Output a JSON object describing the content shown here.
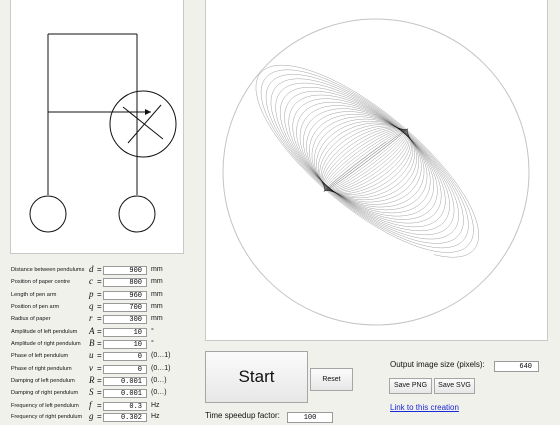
{
  "params": [
    {
      "label": "Distance between pendulums",
      "symbol": "d",
      "value": "900",
      "unit": "mm"
    },
    {
      "label": "Position of paper centre",
      "symbol": "c",
      "value": "800",
      "unit": "mm"
    },
    {
      "label": "Length of pen arm",
      "symbol": "p",
      "value": "960",
      "unit": "mm"
    },
    {
      "label": "Position of pen arm",
      "symbol": "q",
      "value": "700",
      "unit": "mm"
    },
    {
      "label": "Radius of paper",
      "symbol": "r",
      "value": "300",
      "unit": "mm"
    },
    {
      "label": "Amplitude of left pendulum",
      "symbol": "A",
      "value": "10",
      "unit": "°"
    },
    {
      "label": "Amplitude of right pendulum",
      "symbol": "B",
      "value": "10",
      "unit": "°"
    },
    {
      "label": "Phase of left pendulum",
      "symbol": "u",
      "value": "0",
      "unit": "(0…1)"
    },
    {
      "label": "Phase of right pendulum",
      "symbol": "v",
      "value": "0",
      "unit": "(0…1)"
    },
    {
      "label": "Damping of left pendulum",
      "symbol": "R",
      "value": "0.001",
      "unit": "(0…)"
    },
    {
      "label": "Damping of right pendulum",
      "symbol": "S",
      "value": "0.001",
      "unit": "(0…)"
    },
    {
      "label": "Frequency of left pendulum",
      "symbol": "f",
      "value": "0.3",
      "unit": "Hz"
    },
    {
      "label": "Frequency of right pendulum",
      "symbol": "g",
      "value": "0.302",
      "unit": "Hz"
    }
  ],
  "controls": {
    "start_label": "Start",
    "reset_label": "Reset",
    "speedup_label": "Time speedup factor:",
    "speedup_value": "100",
    "output_size_label": "Output image size (pixels):",
    "output_size_value": "640",
    "save_png_label": "Save PNG",
    "save_svg_label": "Save SVG",
    "link_label": "Link to this creation"
  }
}
